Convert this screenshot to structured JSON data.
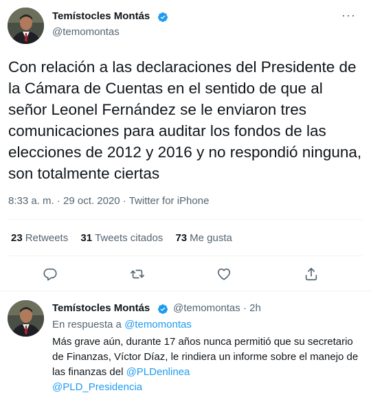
{
  "main_tweet": {
    "author_name": "Temístocles Montás",
    "handle": "@temomontas",
    "text": "Con relación a las declaraciones del Presidente de la Cámara de Cuentas en el sentido de que al señor Leonel Fernández se le enviaron tres comunicaciones para auditar los fondos de las elecciones de 2012 y 2016 y no respondió ninguna, son totalmente ciertas",
    "time": "8:33 a. m.",
    "separator": "·",
    "date": "29 oct. 2020",
    "source": "Twitter for iPhone",
    "stats": {
      "retweets_count": "23",
      "retweets_label": "Retweets",
      "quotes_count": "31",
      "quotes_label": "Tweets citados",
      "likes_count": "73",
      "likes_label": "Me gusta"
    }
  },
  "reply_tweet": {
    "author_name": "Temístocles Montás",
    "handle": "@temomontas",
    "separator": "·",
    "age": "2h",
    "replying_prefix": "En respuesta a",
    "replying_to": "@temomontas",
    "text": "Más grave aún, durante 17 años nunca permitió que su secretario de Finanzas, Víctor Díaz, le rindiera un informe sobre el manejo de las finanzas del",
    "mention_1": "@PLDenlinea",
    "mention_2": "@PLD_Presidencia"
  },
  "icons": {
    "more": "more-icon",
    "reply": "reply-icon",
    "retweet": "retweet-icon",
    "like": "like-icon",
    "share": "share-icon",
    "verified": "verified-badge-icon"
  },
  "colors": {
    "link": "#1d9bf0",
    "secondary_text": "#536471",
    "divider": "#eff3f4"
  }
}
